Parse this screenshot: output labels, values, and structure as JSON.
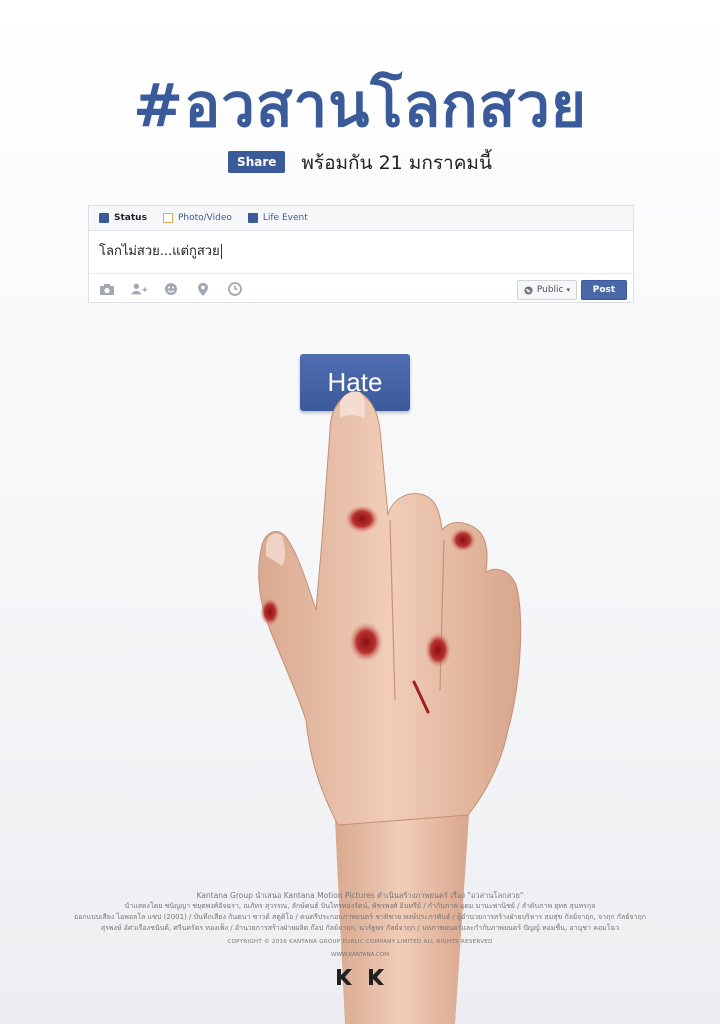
{
  "poster": {
    "title": "#อวสานโลกสวย",
    "share_label": "Share",
    "release_text": "พร้อมกัน 21 มกราคมนี้"
  },
  "composer": {
    "tabs": [
      {
        "label": "Status",
        "icon": "pencil-icon"
      },
      {
        "label": "Photo/Video",
        "icon": "photo-icon"
      },
      {
        "label": "Life Event",
        "icon": "flag-icon"
      }
    ],
    "text": "โลกไม่สวย...แต่กูสวย",
    "toolbar_icons": [
      "camera-icon",
      "tag-person-icon",
      "smiley-icon",
      "location-icon",
      "clock-icon"
    ],
    "privacy_label": "Public",
    "post_label": "Post"
  },
  "hate_button": {
    "label": "Hate"
  },
  "credits": {
    "line1": "Kantana Group นำเสนอ Kantana Motion Pictures ดำเนินสร้างภาพยนตร์ เรื่อง \"อวสานโลกสวย\"",
    "line2": "นำแสดงโดย ชนิญญา ชยุตพงศ์อัจฉรา, ณภัทร สุวรรณ, ลักษ์คนธ์ บินไทรทองรัตน์, พัชรพงศ์ อินทรีย์ / กำกับภาพ อุดม มานะพานิชย์ / ลำดับภาพ ยุทธ สุนทรกุล",
    "line3": "ออกแบบเสียง ไอพอลโล แซป (2001) / บันทึกเสียง กันตนา ซาวด์ สตูดิโอ / ดนตรีประกอบภาพยนตร์ ชาติชาย พงษ์ประภาพันธ์ / ผู้อำนวยการสร้างฝ่ายบริหาร สมสุข กัลย์จาฤก, จาฤก กัลย์จาฤก",
    "line4": "สุรพงษ์ อัศวเรืองชนันต์, ศรีนครัตร ทองเพ็ง / อำนวยการสร้างฝ่ายผลิต ก๊อป กัลย์จาฤก, นวรัฐพร กัลย์จาฤก / บทภาพยนตร์และกำกับภาพยนตร์ ปัญญ์ หอมชื่น, อานุชา คอมโฉว",
    "copyright": "COPYRIGHT © 2016 KANTANA GROUP PUBLIC COMPANY LIMITED ALL RIGHTS RESERVED",
    "website": "WWW.KANTANA.COM"
  }
}
